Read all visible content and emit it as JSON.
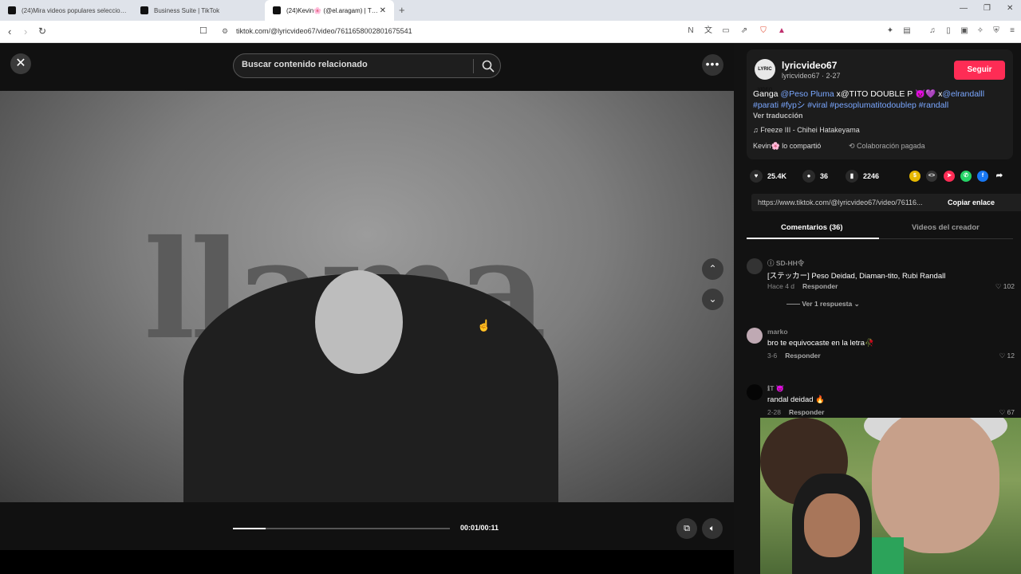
{
  "browser": {
    "tabs": [
      {
        "title": "(24)Mira videos populares seleccio…",
        "active": false
      },
      {
        "title": "Business Suite | TikTok",
        "active": false
      },
      {
        "title": "(24)Kevin🌸 (@el.aragam) | T…",
        "active": true
      }
    ],
    "url": "tiktok.com/@lyricvideo67/video/7611658002801675541"
  },
  "video": {
    "search_placeholder": "Buscar contenido relacionado",
    "overlay_word": "llama",
    "time": "00:01/00:11",
    "progress": 0.15
  },
  "author": {
    "avatar_text": "LYRIC VIDEO",
    "name": "lyricvideo67",
    "sub": "lyricvideo67 · 2-27",
    "follow_label": "Seguir",
    "desc_prefix": "Ganga ",
    "desc_line1_mid": "@Peso Pluma",
    "desc_line1_b": " x@TITO DOUBLE P 👿💜 x",
    "desc_line1_c": "@elrandalll",
    "desc_line2": "#parati #fypシ #viral #pesoplumatitodoublep #randall",
    "translate": "Ver traducción",
    "music": "♫  Freeze III - Chihei Hatakeyama",
    "shared": "Kevin🌸 lo compartió",
    "paid": "⟲  Colaboración pagada"
  },
  "stats": {
    "likes": "25.4K",
    "comments": "36",
    "saves": "2246"
  },
  "link": {
    "url": "https://www.tiktok.com/@lyricvideo67/video/76116...",
    "copy_label": "Copiar enlace"
  },
  "panel_tabs": {
    "comments": "Comentarios (36)",
    "creator": "Videos del creador"
  },
  "comments": [
    {
      "user": "ⓘ SD-HH令",
      "text": "[ステッカー] Peso Deidad, Diaman-tito, Rubi Randall",
      "date": "Hace 4 d",
      "reply": "Responder",
      "likes": "♡ 102",
      "more": "—— Ver 1 respuesta ⌄"
    },
    {
      "user": "marko",
      "text": "bro te equivocaste en la letra🥀",
      "date": "3-6",
      "reply": "Responder",
      "likes": "♡ 12"
    },
    {
      "user": "ℹT 😈",
      "text": "randal deidad 🔥",
      "date": "2-28",
      "reply": "Responder",
      "likes": "♡ 67"
    }
  ]
}
